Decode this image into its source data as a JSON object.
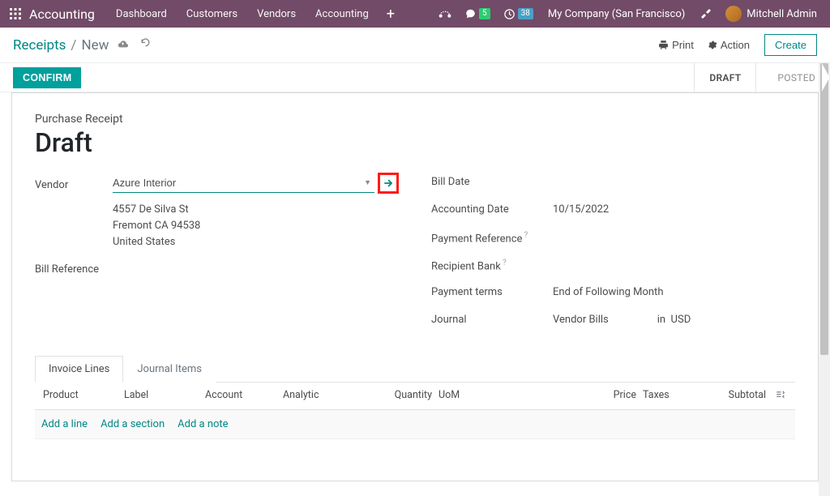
{
  "topnav": {
    "brand": "Accounting",
    "links": [
      "Dashboard",
      "Customers",
      "Vendors",
      "Accounting"
    ],
    "chat_badge": "5",
    "clock_badge": "38",
    "company": "My Company (San Francisco)",
    "username": "Mitchell Admin"
  },
  "controlbar": {
    "crumb_root": "Receipts",
    "crumb_current": "New",
    "print": "Print",
    "action": "Action",
    "create": "Create"
  },
  "statusrow": {
    "confirm": "CONFIRM",
    "steps": {
      "draft": "DRAFT",
      "posted": "POSTED"
    }
  },
  "doc": {
    "type": "Purchase Receipt",
    "title": "Draft",
    "vendor_label": "Vendor",
    "vendor_value": "Azure Interior",
    "vendor_addr1": "4557 De Silva St",
    "vendor_addr2": "Fremont CA 94538",
    "vendor_addr3": "United States",
    "billref_label": "Bill Reference",
    "billdate_label": "Bill Date",
    "acctdate_label": "Accounting Date",
    "acctdate_value": "10/15/2022",
    "payref_label": "Payment Reference",
    "recipbank_label": "Recipient Bank",
    "payterms_label": "Payment terms",
    "payterms_value": "End of Following Month",
    "journal_label": "Journal",
    "journal_value": "Vendor Bills",
    "journal_in": "in",
    "journal_currency": "USD"
  },
  "tabs": {
    "invoice_lines": "Invoice Lines",
    "journal_items": "Journal Items"
  },
  "lines": {
    "col_product": "Product",
    "col_label": "Label",
    "col_account": "Account",
    "col_analytic": "Analytic",
    "col_qty": "Quantity",
    "col_uom": "UoM",
    "col_price": "Price",
    "col_taxes": "Taxes",
    "col_subtotal": "Subtotal",
    "add_line": "Add a line",
    "add_section": "Add a section",
    "add_note": "Add a note"
  }
}
